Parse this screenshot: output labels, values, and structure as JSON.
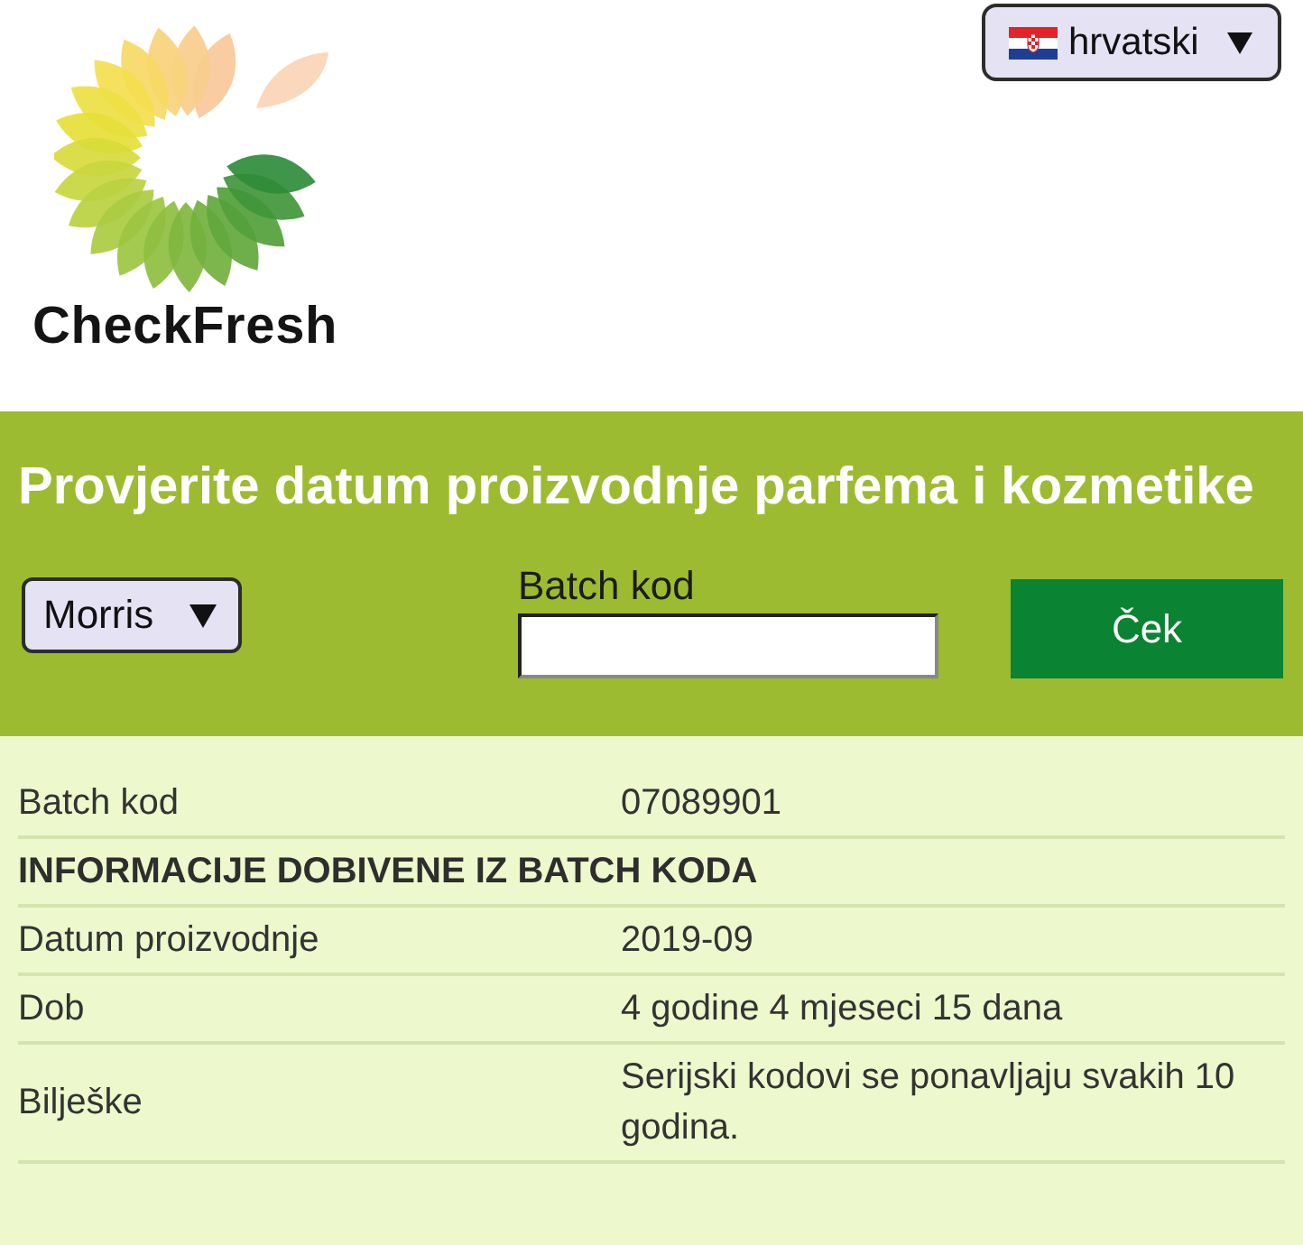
{
  "header": {
    "logo_text": "CheckFresh",
    "language_select": {
      "value": "hrvatski"
    }
  },
  "search": {
    "title": "Provjerite datum proizvodnje parfema i kozmetike",
    "brand_select": {
      "value": "Morris"
    },
    "batch_field": {
      "label": "Batch kod"
    },
    "submit_button": "Ček"
  },
  "results": {
    "rows": [
      {
        "kind": "pair",
        "label": "Batch kod",
        "value": "07089901"
      },
      {
        "kind": "heading",
        "label": "INFORMACIJE DOBIVENE IZ BATCH KODA"
      },
      {
        "kind": "pair",
        "label": "Datum proizvodnje",
        "value": "2019-09"
      },
      {
        "kind": "pair",
        "label": "Dob",
        "value": "4 godine 4 mjeseci 15 dana"
      },
      {
        "kind": "pair",
        "label": "Bilješke",
        "value": "Serijski kodovi se ponavljaju svakih 10 godina."
      }
    ]
  }
}
